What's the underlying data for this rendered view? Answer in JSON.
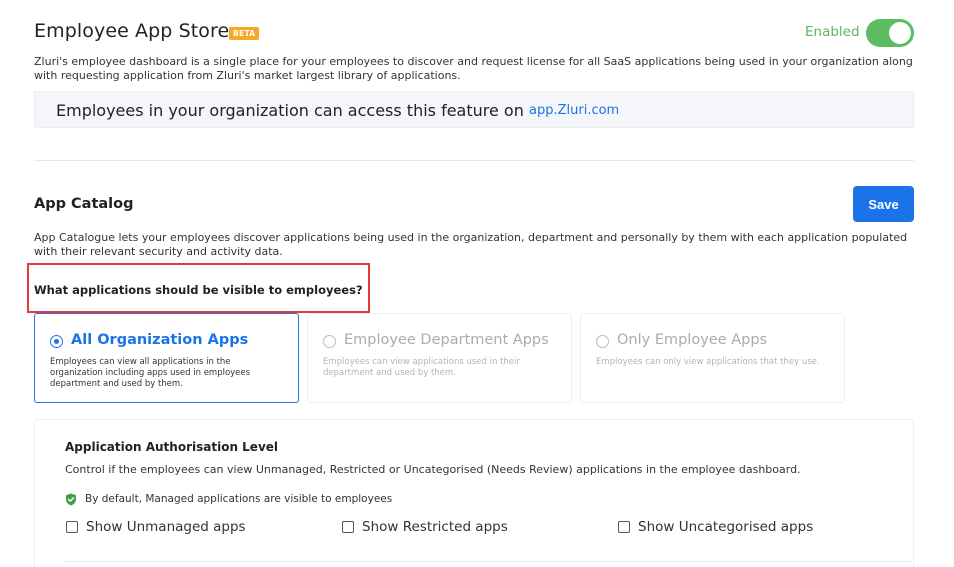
{
  "header": {
    "title": "Employee App Store",
    "badge": "BETA",
    "toggle_label": "Enabled",
    "toggle_on": true
  },
  "intro": "Zluri's employee dashboard is a single place for your employees to discover and request license for all SaaS applications being used in your organization along with requesting application from Zluri's market largest library of applications.",
  "notice": {
    "text": "Employees in your organization can access this feature on",
    "link": "app.Zluri.com"
  },
  "catalog": {
    "title": "App Catalog",
    "save_label": "Save",
    "description": "App Catalogue lets your employees discover applications being used in the organization, department and personally by them with each application populated with their relevant security and activity data.",
    "question": "What applications should be visible to employees?",
    "options": [
      {
        "title": "All Organization Apps",
        "description": "Employees can view all applications in the organization including apps used in employees department and used by them.",
        "selected": true
      },
      {
        "title": "Employee Department Apps",
        "description": "Employees can view applications used in their department and used by them.",
        "selected": false
      },
      {
        "title": "Only Employee Apps",
        "description": "Employees can only view applications that they use.",
        "selected": false
      }
    ]
  },
  "authorisation": {
    "title": "Application Authorisation Level",
    "description": "Control if the employees can view Unmanaged, Restricted or Uncategorised (Needs Review) applications in the employee dashboard.",
    "default_note": "By default, Managed applications are visible to employees",
    "checkboxes": [
      {
        "label": "Show Unmanaged apps",
        "checked": false
      },
      {
        "label": "Show Restricted apps",
        "checked": false
      },
      {
        "label": "Show Uncategorised apps",
        "checked": false
      }
    ]
  },
  "colors": {
    "accent": "#1a73e8",
    "enabled_green": "#5cbc64",
    "beta_badge": "#f9a825",
    "highlight_red": "#e53935"
  },
  "icons": {
    "default_note_icon": "shield-check-icon"
  }
}
